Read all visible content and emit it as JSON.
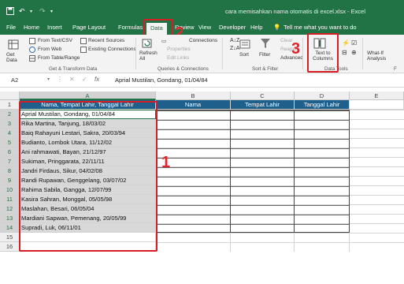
{
  "window": {
    "title": "cara memisahkan nama otomatis di excel.xlsx - Excel"
  },
  "quick_access": {
    "save_icon": "save-icon",
    "undo_icon": "undo-icon",
    "redo_icon": "redo-icon"
  },
  "tabs": [
    "File",
    "Home",
    "Insert",
    "Page Layout",
    "Formulas",
    "Data",
    "Review",
    "View",
    "Developer",
    "Help"
  ],
  "tell_me": "Tell me what you want to do",
  "ribbon": {
    "get_data": "Get Data",
    "from_text_csv": "From Text/CSV",
    "from_web": "From Web",
    "from_table_range": "From Table/Range",
    "recent_sources": "Recent Sources",
    "existing_connections": "Existing Connections",
    "refresh_all": "Refresh All",
    "connections": "Connections",
    "properties": "Properties",
    "edit_links": "Edit Links",
    "sort": "Sort",
    "filter": "Filter",
    "clear": "Clear",
    "reapply": "Reapply",
    "advanced": "Advanced",
    "text_to_columns": "Text to Columns",
    "what_if": "What-If Analysis",
    "group_get_transform": "Get & Transform Data",
    "group_queries": "Queries & Connections",
    "group_sort_filter": "Sort & Filter",
    "group_data_tools": "Data Tools"
  },
  "formula_bar": {
    "name_box": "A2",
    "content": "Aprial Mustilan, Gondang, 01/04/84"
  },
  "columns": [
    "A",
    "B",
    "C",
    "D",
    "E"
  ],
  "rows": [
    "1",
    "2",
    "3",
    "4",
    "5",
    "6",
    "7",
    "8",
    "9",
    "10",
    "11",
    "12",
    "13",
    "14",
    "15",
    "16"
  ],
  "headers": [
    "Nama, Tempat Lahir, Tanggal Lahir",
    "Nama",
    "Tempat Lahir",
    "Tanggal Lahir"
  ],
  "data_rows": [
    "Aprial Mustilan, Gondang, 01/04/84",
    "Rika Martina, Tanjung, 18/03/02",
    "Baiq Rahayuni Lestari, Sakra, 20/03/94",
    "Budianto, Lombok Utara, 11/12/02",
    "Ani rahmawati, Bayan, 21/12/97",
    "Sukiman, Pringgarata, 22/11/11",
    "Jandri Firdaus, Sikur, 04/02/08",
    "Randi Rupawan, Genggelang, 03/07/02",
    "Rahima Sabila, Gangga, 12/07/99",
    "Kasira Sahran, Monggal, 05/05/98",
    "Maslahan, Besari, 06/05/04",
    "Mardiani Sapwan, Pemenang, 20/05/99",
    "Supradi, Luk, 06/11/01"
  ],
  "annotations": [
    "1",
    "2",
    "3"
  ],
  "colors": {
    "excel_green": "#217346",
    "header_blue": "#1f5f8b",
    "annotation_red": "#d81e25"
  }
}
